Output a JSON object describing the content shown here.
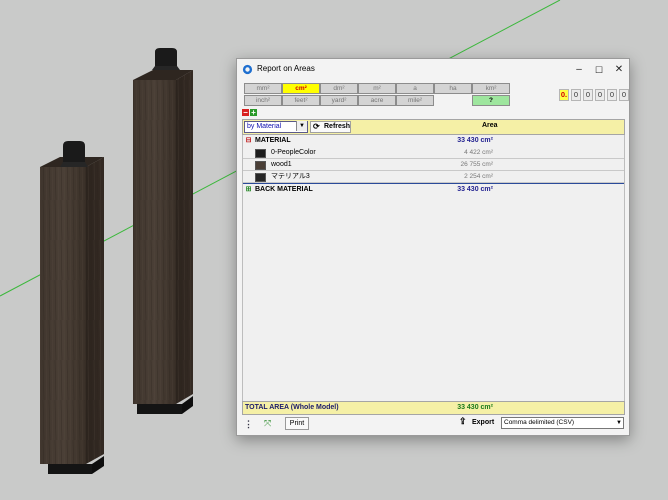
{
  "window": {
    "title": "Report on Areas",
    "controls": [
      "–",
      "☐",
      "✕"
    ]
  },
  "units": {
    "row1": [
      "mm²",
      "cm²",
      "dm²",
      "m²",
      "a",
      "ha",
      "km²"
    ],
    "row2": [
      "inch²",
      "feet²",
      "yard²",
      "acre",
      "mile²"
    ],
    "active": "cm²",
    "help_label": "?"
  },
  "precision_digits": [
    "0.",
    "0",
    "0",
    "0",
    "0",
    "0"
  ],
  "tree_controls": {
    "collapse": "−",
    "expand": "+"
  },
  "toolbar": {
    "group_by": "by Material",
    "refresh_label": "Refresh",
    "area_header": "Area"
  },
  "rows": [
    {
      "kind": "group",
      "toggle": "⊟",
      "name": "MATERIAL",
      "value": "33 430 cm²"
    },
    {
      "kind": "sub",
      "name": "0-PeopleColor",
      "value": "4 422 cm²",
      "swatch": "#1c1c1c"
    },
    {
      "kind": "sub",
      "name": "wood1",
      "value": "26 755 cm²",
      "swatch": "#4a3f36"
    },
    {
      "kind": "sub",
      "name": "マテリアル3",
      "value": "2 254 cm²",
      "swatch": "#262626"
    },
    {
      "kind": "group",
      "toggle": "⊞",
      "name": "BACK MATERIAL",
      "value": "33 430 cm²"
    }
  ],
  "total": {
    "label": "TOTAL AREA (Whole Model)",
    "value": "33 430 cm²"
  },
  "bottom": {
    "print_label": "Print",
    "export_label": "Export",
    "format": "Comma delimited (CSV)"
  },
  "colors": {
    "highlight_yellow": "#f5f0a6",
    "active_unit": "#ffff00",
    "help_green": "#9ee69e",
    "axis_green": "#3cb83c"
  }
}
